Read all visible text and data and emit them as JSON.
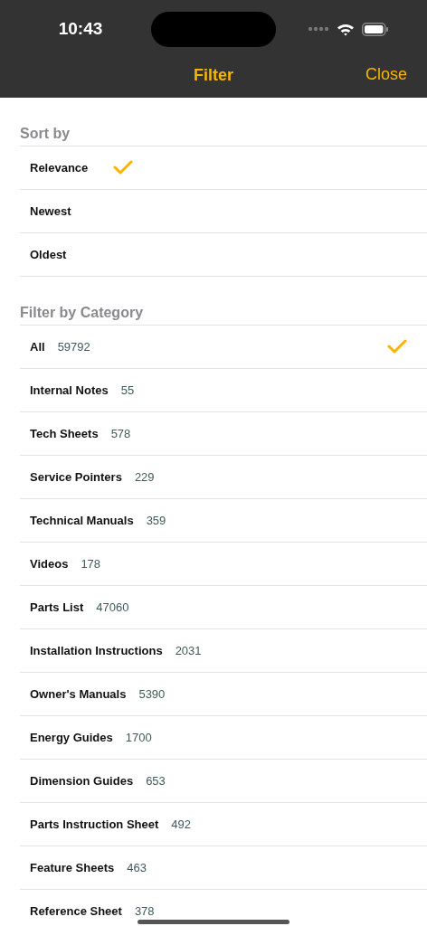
{
  "status_bar": {
    "time": "10:43"
  },
  "nav_bar": {
    "title": "Filter",
    "close": "Close"
  },
  "sections": [
    {
      "kind": "inline",
      "title": "Sort by",
      "items": [
        {
          "label": "Relevance",
          "selected": true
        },
        {
          "label": "Newest",
          "selected": false
        },
        {
          "label": "Oldest",
          "selected": false
        }
      ]
    },
    {
      "kind": "trailing",
      "title": "Filter by Category",
      "items": [
        {
          "label": "All",
          "count": "59792",
          "selected": true
        },
        {
          "label": "Internal Notes",
          "count": "55",
          "selected": false
        },
        {
          "label": "Tech Sheets",
          "count": "578",
          "selected": false
        },
        {
          "label": "Service Pointers",
          "count": "229",
          "selected": false
        },
        {
          "label": "Technical Manuals",
          "count": "359",
          "selected": false
        },
        {
          "label": "Videos",
          "count": "178",
          "selected": false
        },
        {
          "label": "Parts List",
          "count": "47060",
          "selected": false
        },
        {
          "label": "Installation Instructions",
          "count": "2031",
          "selected": false
        },
        {
          "label": "Owner's Manuals",
          "count": "5390",
          "selected": false
        },
        {
          "label": "Energy Guides",
          "count": "1700",
          "selected": false
        },
        {
          "label": "Dimension Guides",
          "count": "653",
          "selected": false
        },
        {
          "label": "Parts Instruction Sheet",
          "count": "492",
          "selected": false
        },
        {
          "label": "Feature Sheets",
          "count": "463",
          "selected": false
        },
        {
          "label": "Reference Sheet",
          "count": "378",
          "selected": false
        }
      ]
    }
  ]
}
